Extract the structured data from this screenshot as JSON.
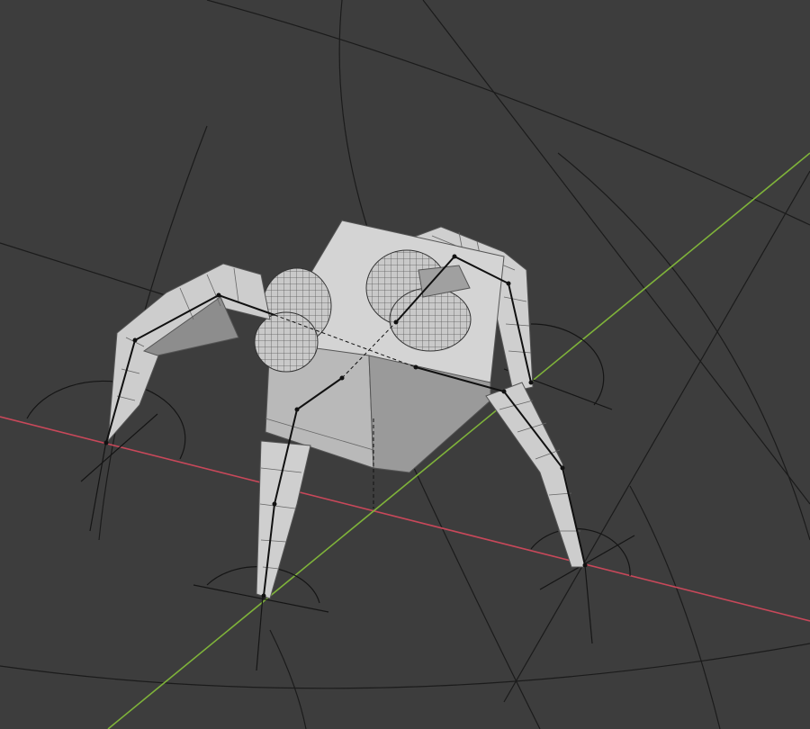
{
  "viewport": {
    "background_color": "#3d3d3d",
    "guide_line_color": "#1a1a1a",
    "x_axis_color": "#c8485a",
    "y_axis_color": "#7fb33a",
    "mesh_light": "#d2d2d2",
    "mesh_mid": "#a9a9a9",
    "mesh_dark": "#6e6e6e",
    "wire_color": "#555555",
    "bone_color": "#111111"
  },
  "scene": {
    "object_type": "mesh-with-armature",
    "shading": "solid",
    "overlays": [
      "grid-guides",
      "x-axis",
      "y-axis",
      "wireframe",
      "bones",
      "joint-limit-arcs"
    ],
    "objects": [
      {
        "name": "body-cube",
        "kind": "mesh"
      },
      {
        "name": "eye-left",
        "kind": "mesh"
      },
      {
        "name": "eye-right",
        "kind": "mesh"
      },
      {
        "name": "leg-front-left",
        "kind": "mesh"
      },
      {
        "name": "leg-front-right",
        "kind": "mesh"
      },
      {
        "name": "leg-back-left",
        "kind": "mesh"
      },
      {
        "name": "leg-back-right",
        "kind": "mesh"
      }
    ]
  }
}
